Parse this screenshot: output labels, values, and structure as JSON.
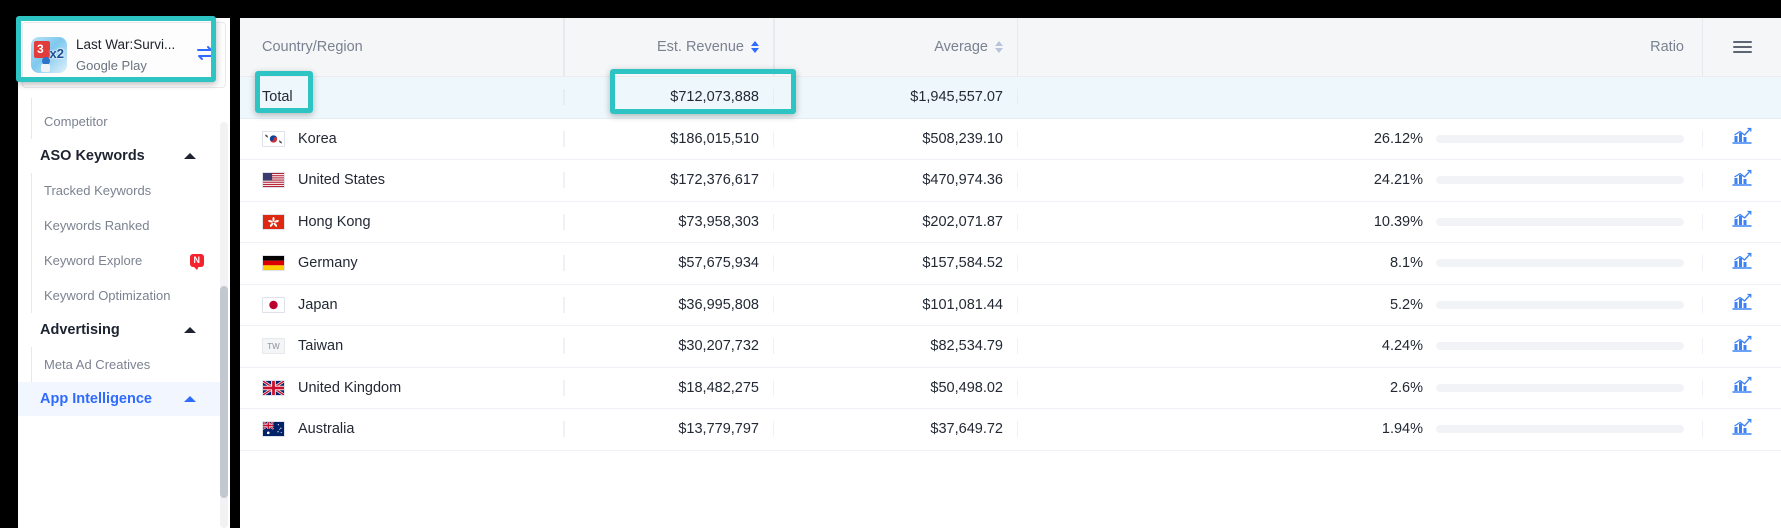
{
  "sidebar": {
    "app_card": {
      "title": "Last War:Survi...",
      "store": "Google Play",
      "icon_name": "app-icon-last-war",
      "badge": "x2",
      "swap_icon": "swap-icon"
    },
    "items": [
      {
        "label": "Competitor",
        "type": "sub",
        "badge": null
      },
      {
        "label": "ASO Keywords",
        "type": "group",
        "expanded": true
      },
      {
        "label": "Tracked Keywords",
        "type": "sub",
        "badge": null
      },
      {
        "label": "Keywords Ranked",
        "type": "sub",
        "badge": null
      },
      {
        "label": "Keyword Explore",
        "type": "sub",
        "badge": "N"
      },
      {
        "label": "Keyword Optimization",
        "type": "sub",
        "badge": null
      },
      {
        "label": "Advertising",
        "type": "group",
        "expanded": true
      },
      {
        "label": "Meta Ad Creatives",
        "type": "sub",
        "badge": null
      },
      {
        "label": "App Intelligence",
        "type": "group",
        "expanded": true,
        "active": true
      }
    ]
  },
  "table": {
    "columns": [
      {
        "key": "country",
        "label": "Country/Region",
        "align": "left",
        "sortable": false,
        "sorted": false
      },
      {
        "key": "revenue",
        "label": "Est. Revenue",
        "align": "right",
        "sortable": true,
        "sorted": true
      },
      {
        "key": "average",
        "label": "Average",
        "align": "right",
        "sortable": true,
        "sorted": false
      },
      {
        "key": "ratio",
        "label": "Ratio",
        "align": "right",
        "sortable": false,
        "sorted": false
      }
    ],
    "menu_icon": "hamburger-menu-icon",
    "total_row": {
      "label": "Total",
      "revenue": "$712,073,888",
      "average": "$1,945,557.07"
    },
    "rows": [
      {
        "country": "Korea",
        "flag": "kr",
        "revenue": "$186,015,510",
        "average": "$508,239.10",
        "ratio": "26.12%",
        "ratio_value": 26.12,
        "chart_icon": "bar-chart-icon"
      },
      {
        "country": "United States",
        "flag": "us",
        "revenue": "$172,376,617",
        "average": "$470,974.36",
        "ratio": "24.21%",
        "ratio_value": 24.21,
        "chart_icon": "bar-chart-icon"
      },
      {
        "country": "Hong Kong",
        "flag": "hk",
        "revenue": "$73,958,303",
        "average": "$202,071.87",
        "ratio": "10.39%",
        "ratio_value": 10.39,
        "chart_icon": "bar-chart-icon"
      },
      {
        "country": "Germany",
        "flag": "de",
        "revenue": "$57,675,934",
        "average": "$157,584.52",
        "ratio": "8.1%",
        "ratio_value": 8.1,
        "chart_icon": "bar-chart-icon"
      },
      {
        "country": "Japan",
        "flag": "jp",
        "revenue": "$36,995,808",
        "average": "$101,081.44",
        "ratio": "5.2%",
        "ratio_value": 5.2,
        "chart_icon": "bar-chart-icon"
      },
      {
        "country": "Taiwan",
        "flag": "tw",
        "revenue": "$30,207,732",
        "average": "$82,534.79",
        "ratio": "4.24%",
        "ratio_value": 4.24,
        "chart_icon": "bar-chart-icon"
      },
      {
        "country": "United Kingdom",
        "flag": "gb",
        "revenue": "$18,482,275",
        "average": "$50,498.02",
        "ratio": "2.6%",
        "ratio_value": 2.6,
        "chart_icon": "bar-chart-icon"
      },
      {
        "country": "Australia",
        "flag": "au",
        "revenue": "$13,779,797",
        "average": "$37,649.72",
        "ratio": "1.94%",
        "ratio_value": 1.94,
        "chart_icon": "bar-chart-icon"
      }
    ]
  },
  "highlights": [
    {
      "name": "app-card-highlight",
      "color": "#2ec4c4"
    },
    {
      "name": "total-label-highlight",
      "color": "#2ec4c4"
    },
    {
      "name": "total-revenue-highlight",
      "color": "#2ec4c4"
    }
  ],
  "colors": {
    "accent_blue": "#2f6bff",
    "bar_blue": "#1a6df0",
    "highlight_teal": "#2ec4c4",
    "total_row_bg": "#eef8fc",
    "badge_red": "#f5222d"
  }
}
